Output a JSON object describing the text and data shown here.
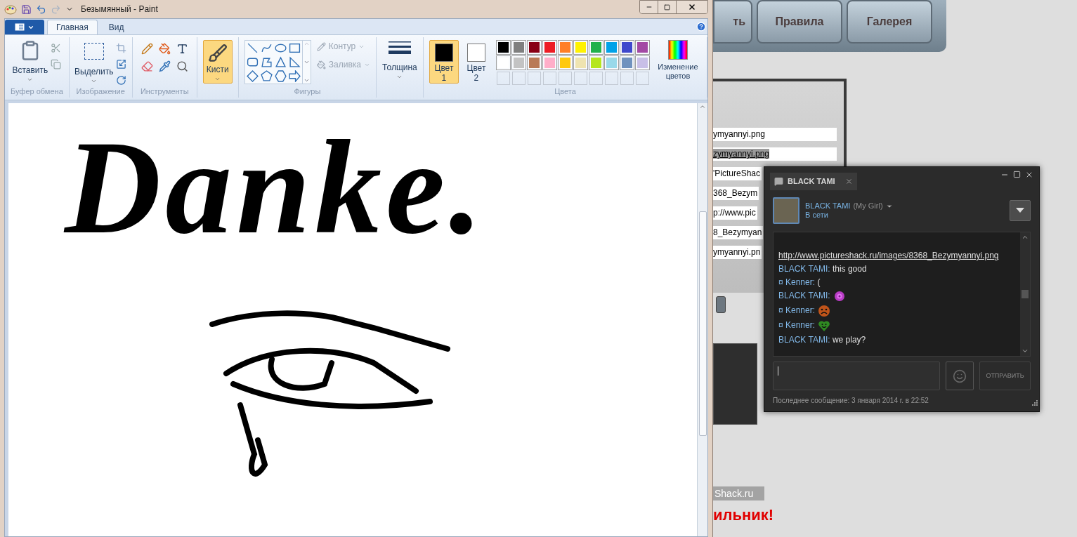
{
  "paint": {
    "title": "Безымянный - Paint",
    "tabs": [
      {
        "label": "Главная",
        "selected": true
      },
      {
        "label": "Вид",
        "selected": false
      }
    ],
    "clipboard": {
      "paste": "Вставить",
      "label": "Буфер обмена"
    },
    "image": {
      "select": "Выделить",
      "label": "Изображение"
    },
    "tools": {
      "label": "Инструменты"
    },
    "brushes": {
      "label": "Кисти",
      "selected": true
    },
    "shapes": {
      "label": "Фигуры",
      "options": [
        {
          "label": "Контур",
          "disabled": true
        },
        {
          "label": "Заливка",
          "disabled": true
        }
      ]
    },
    "size": {
      "label": "Толщина"
    },
    "colors": {
      "label": "Цвета",
      "edit": "Изменение цветов",
      "slots": [
        {
          "label": "Цвет 1",
          "selected": true,
          "color": "#000000"
        },
        {
          "label": "Цвет 2",
          "selected": false,
          "color": "#ffffff"
        }
      ],
      "palette": [
        {
          "color": "#000000"
        },
        {
          "color": "#7f7f7f"
        },
        {
          "color": "#880015"
        },
        {
          "color": "#ed1c24"
        },
        {
          "color": "#ff7f27"
        },
        {
          "color": "#fff200"
        },
        {
          "color": "#22b14c"
        },
        {
          "color": "#00a2e8"
        },
        {
          "color": "#3f48cc"
        },
        {
          "color": "#a349a4"
        },
        {
          "color": "#ffffff"
        },
        {
          "color": "#c3c3c3"
        },
        {
          "color": "#b97a57"
        },
        {
          "color": "#ffaec9"
        },
        {
          "color": "#ffc90e"
        },
        {
          "color": "#efe4b0"
        },
        {
          "color": "#b5e61d"
        },
        {
          "color": "#99d9ea"
        },
        {
          "color": "#7092be"
        },
        {
          "color": "#c8bfe7"
        }
      ]
    },
    "canvas": {
      "text": "Danke."
    }
  },
  "website": {
    "nav": [
      "ть",
      "Правила",
      "Галерея"
    ],
    "fields": [
      {
        "value": "ymyannyi.png",
        "selected": false
      },
      {
        "value": "zymyannyi.png",
        "selected": true
      },
      {
        "value": "'PictureShac",
        "selected": false
      },
      {
        "value": "368_Bezym",
        "selected": false
      },
      {
        "value": "p://www.pic",
        "selected": false
      },
      {
        "value": "8_Bezymyan",
        "selected": false
      },
      {
        "value": "ymyannyi.pn",
        "selected": false
      }
    ],
    "footer": "Shack.ru",
    "heading": "ильник!"
  },
  "chat": {
    "tab": "BLACK TAMI",
    "friend": {
      "name": "BLACK TAMI",
      "nickname": "(My Girl)",
      "status": "В сети"
    },
    "messages": [
      {
        "kind": "link",
        "text": "http://www.pictureshack.ru/images/8368_Bezymyannyi.png"
      },
      {
        "kind": "text",
        "sender": "BLACK TAMI:",
        "text": "this good"
      },
      {
        "kind": "text",
        "sender": "¤ Kenner:",
        "text": "("
      },
      {
        "kind": "rose",
        "sender": "BLACK TAMI:"
      },
      {
        "kind": "sad",
        "sender": "¤ Kenner:"
      },
      {
        "kind": "heart",
        "sender": "¤ Kenner:"
      },
      {
        "kind": "text",
        "sender": "BLACK TAMI:",
        "text": "we play?"
      }
    ],
    "send": "ОТПРАВИТЬ",
    "footer": "Последнее сообщение: 3 января 2014 г. в 22:52"
  }
}
